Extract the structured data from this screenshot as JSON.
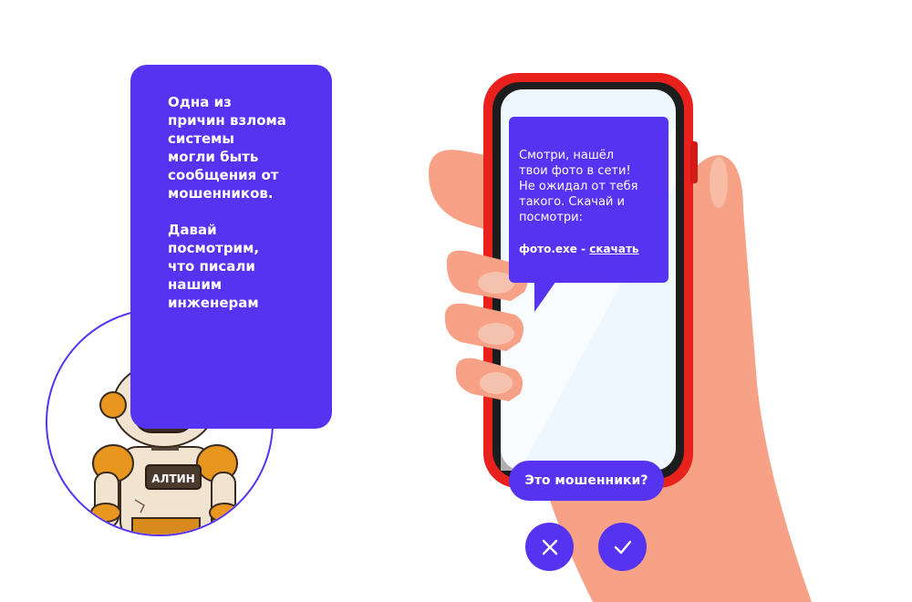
{
  "mascot": {
    "badge_label": "АЛТИН",
    "icon": "robot-mascot-icon"
  },
  "speech": {
    "paragraph_1": "Одна из\nпричин взлома\nсистемы\nмогли быть\nсообщения от\nмошенников.",
    "paragraph_2": "Давай\nпосмотрим,\nчто писали\nнашим\nинженерам"
  },
  "phone": {
    "message_text": "Смотри, нашёл\nтвои фото в сети!\nНе ожидал от тебя\nтакого. Скачай и\nпосмотри:",
    "attachment_name": "фото.exe -",
    "attachment_link": "скачать"
  },
  "quiz": {
    "question": "Это мошенники?",
    "no_icon": "close-icon",
    "yes_icon": "check-icon"
  },
  "colors": {
    "accent": "#5533f0",
    "phone_frame": "#e8211d",
    "skin": "#f7a286"
  }
}
